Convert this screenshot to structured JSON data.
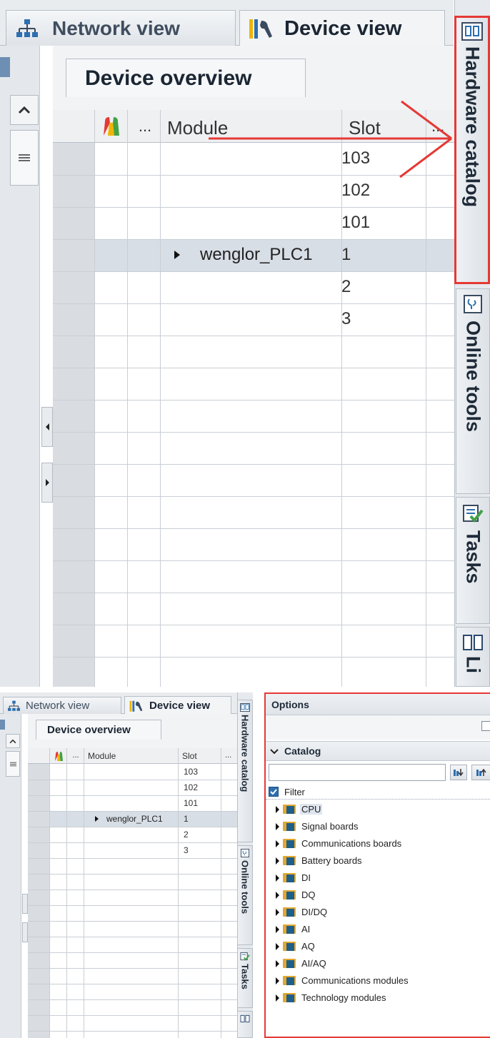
{
  "top": {
    "tabs": {
      "network_view": "Network view",
      "device_view": "Device view"
    },
    "device_overview_tab": "Device overview",
    "columns": {
      "ellipsis": "...",
      "module": "Module",
      "slot": "Slot",
      "more": "..."
    },
    "rows": [
      {
        "module": "",
        "slot": "103"
      },
      {
        "module": "",
        "slot": "102"
      },
      {
        "module": "",
        "slot": "101"
      },
      {
        "module": "wenglor_PLC1",
        "slot": "1"
      },
      {
        "module": "",
        "slot": "2"
      },
      {
        "module": "",
        "slot": "3"
      }
    ],
    "side_tabs": {
      "hardware_catalog": "Hardware catalog",
      "online_tools": "Online tools",
      "tasks": "Tasks",
      "libraries": "Li"
    },
    "annotation_color": "#e53935"
  },
  "bottom": {
    "tabs": {
      "network_view": "Network view",
      "device_view": "Device view"
    },
    "device_overview_tab": "Device overview",
    "columns": {
      "ellipsis": "...",
      "module": "Module",
      "slot": "Slot",
      "more": "..."
    },
    "rows": [
      {
        "module": "",
        "slot": "103"
      },
      {
        "module": "",
        "slot": "102"
      },
      {
        "module": "",
        "slot": "101"
      },
      {
        "module": "wenglor_PLC1",
        "slot": "1"
      },
      {
        "module": "",
        "slot": "2"
      },
      {
        "module": "",
        "slot": "3"
      }
    ],
    "side_tabs": {
      "hardware_catalog": "Hardware catalog",
      "online_tools": "Online tools",
      "tasks": "Tasks"
    },
    "catalog_panel": {
      "options_header": "Options",
      "catalog_header": "Catalog",
      "search_placeholder": "",
      "filter_label": "Filter",
      "filter_checked": true,
      "items": [
        "CPU",
        "Signal boards",
        "Communications boards",
        "Battery boards",
        "DI",
        "DQ",
        "DI/DQ",
        "AI",
        "AQ",
        "AI/AQ",
        "Communications modules",
        "Technology modules"
      ]
    }
  }
}
